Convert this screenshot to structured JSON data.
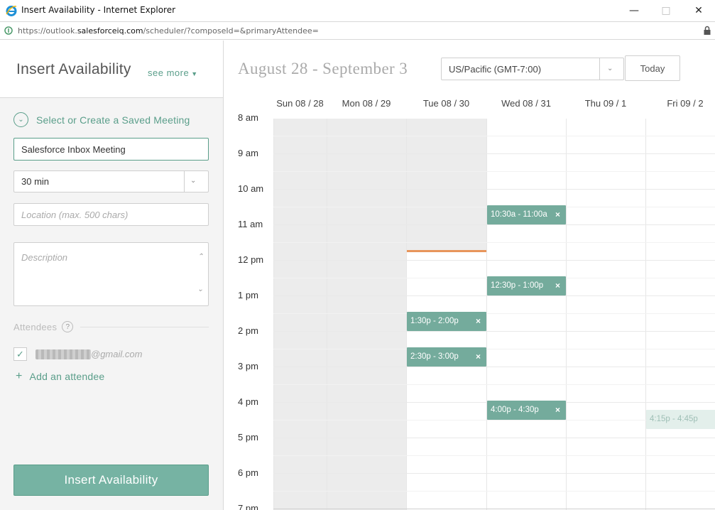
{
  "window": {
    "title": "Insert Availability - Internet Explorer",
    "url_prefix": "https://outlook.",
    "url_domain": "salesforceiq.com",
    "url_rest": "/scheduler/?composeId=&primaryAttendee="
  },
  "sidebar": {
    "title": "Insert Availability",
    "see_more": "see more",
    "saved_meeting_label": "Select or Create a Saved Meeting",
    "meeting_name": "Salesforce Inbox Meeting",
    "duration": "30 min",
    "location_placeholder": "Location (max. 500 chars)",
    "description_placeholder": "Description",
    "attendees_label": "Attendees",
    "attendee_email": "@gmail.com",
    "add_attendee": "Add an attendee",
    "insert_button": "Insert Availability"
  },
  "calendar": {
    "date_range": "August 28 - September 3",
    "timezone": "US/Pacific (GMT-7:00)",
    "today_label": "Today",
    "days": [
      "Sun 08 / 28",
      "Mon 08 / 29",
      "Tue 08 / 30",
      "Wed 08 / 31",
      "Thu 09 / 1",
      "Fri 09 / 2"
    ],
    "hours": [
      "8 am",
      "9 am",
      "10 am",
      "11 am",
      "12 pm",
      "1 pm",
      "2 pm",
      "3 pm",
      "4 pm",
      "5 pm",
      "6 pm",
      "7 pm"
    ],
    "slots": [
      {
        "day": 3,
        "label": "10:30a - 11:00a",
        "start_hour": 10.5
      },
      {
        "day": 3,
        "label": "12:30p - 1:00p",
        "start_hour": 12.5
      },
      {
        "day": 2,
        "label": "1:30p - 2:00p",
        "start_hour": 13.5
      },
      {
        "day": 2,
        "label": "2:30p - 3:00p",
        "start_hour": 14.5
      },
      {
        "day": 3,
        "label": "4:00p - 4:30p",
        "start_hour": 16.0
      },
      {
        "day": 5,
        "label": "4:15p - 4:45p",
        "start_hour": 16.25
      }
    ],
    "current_time_hour": 11.72,
    "accent_color": "#74ab9c",
    "now_line_color": "#e8955b"
  }
}
